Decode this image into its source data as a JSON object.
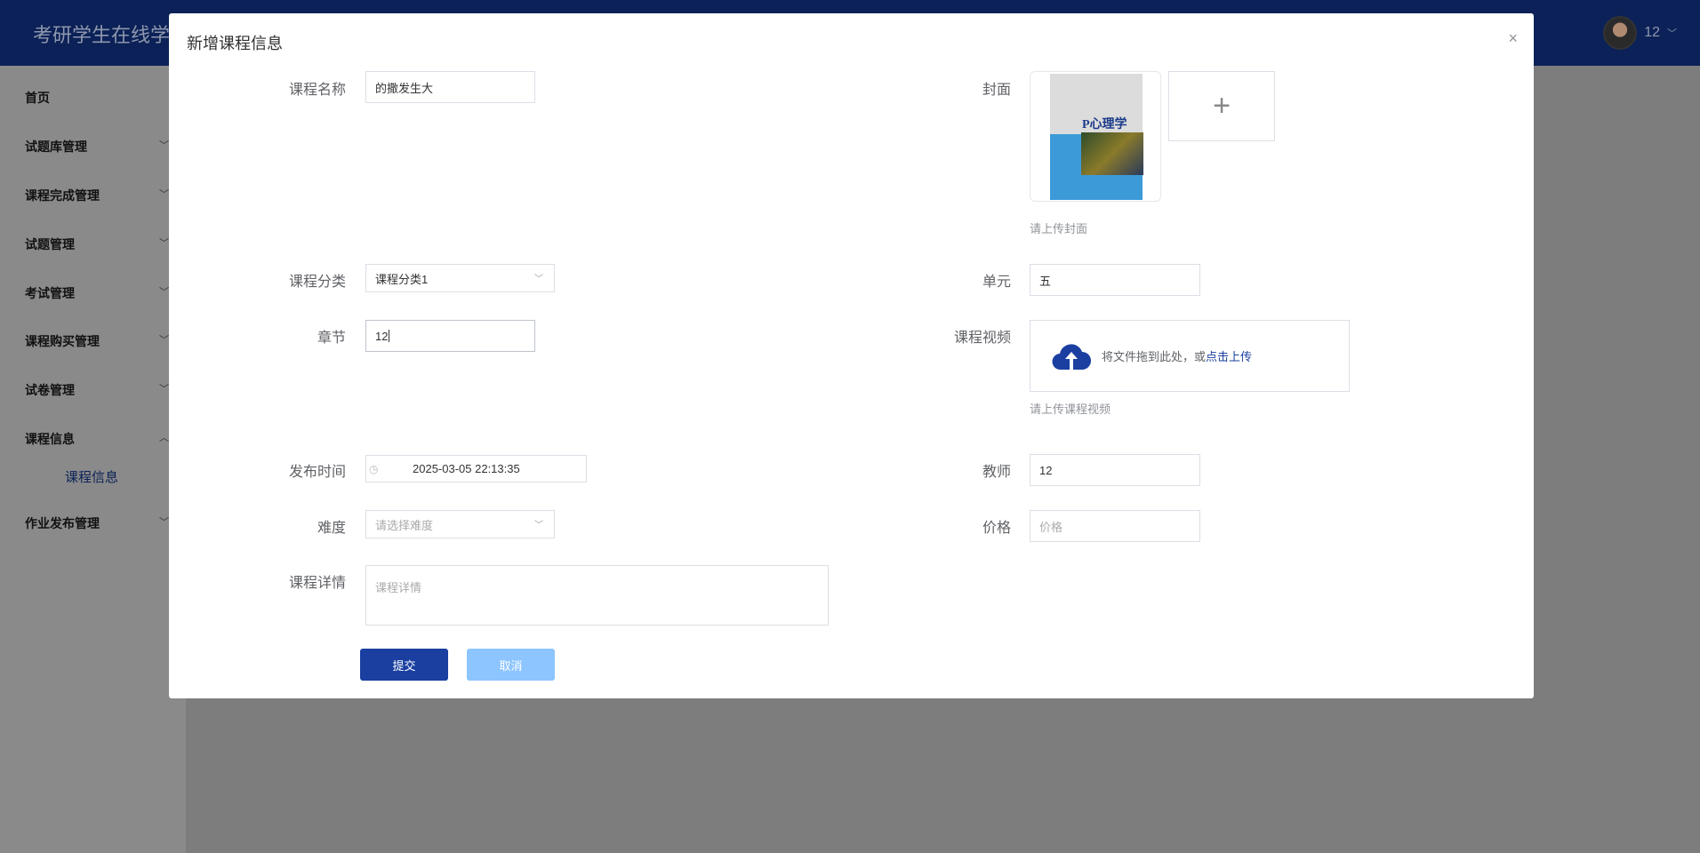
{
  "header": {
    "app_title": "考研学生在线学习",
    "username": "12"
  },
  "sidebar": {
    "items": [
      {
        "label": "首页",
        "chevron": ""
      },
      {
        "label": "试题库管理",
        "chevron": "﹀"
      },
      {
        "label": "课程完成管理",
        "chevron": "﹀"
      },
      {
        "label": "试题管理",
        "chevron": "﹀"
      },
      {
        "label": "考试管理",
        "chevron": "﹀"
      },
      {
        "label": "课程购买管理",
        "chevron": "﹀"
      },
      {
        "label": "试卷管理",
        "chevron": "﹀"
      },
      {
        "label": "课程信息",
        "chevron": "︿"
      },
      {
        "label": "作业发布管理",
        "chevron": "﹀"
      }
    ],
    "sub_item": "课程信息"
  },
  "dialog": {
    "title": "新增课程信息",
    "close": "×",
    "form": {
      "name_label": "课程名称",
      "name_value": "的撒发生大",
      "cover_label": "封面",
      "cover_hint": "请上传封面",
      "cover_plus": "+",
      "category_label": "课程分类",
      "category_value": "课程分类1",
      "unit_label": "单元",
      "unit_value": "五",
      "chapter_label": "章节",
      "chapter_value": "12",
      "video_label": "课程视频",
      "video_drop_text": "将文件拖到此处，或",
      "video_click_text": "点击上传",
      "video_hint": "请上传课程视频",
      "publish_label": "发布时间",
      "publish_value": "2025-03-05 22:13:35",
      "teacher_label": "教师",
      "teacher_value": "12",
      "difficulty_label": "难度",
      "difficulty_placeholder": "请选择难度",
      "price_label": "价格",
      "price_placeholder": "价格",
      "detail_label": "课程详情",
      "detail_placeholder": "课程详情"
    },
    "submit": "提交",
    "cancel": "取消"
  },
  "colors": {
    "primary": "#1a3fa0",
    "cancel": "#8cc5ff",
    "header": "#0b2157"
  }
}
